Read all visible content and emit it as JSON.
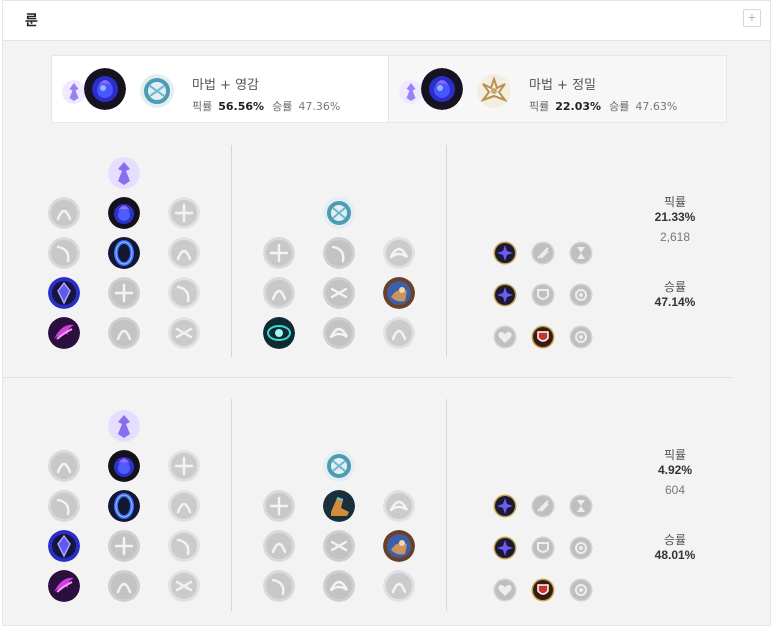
{
  "header": {
    "title": "룬",
    "add_button": "+"
  },
  "summaries": [
    {
      "primary": "마법",
      "secondary": "영감",
      "title": "마법 + 영감",
      "pick_label": "픽률",
      "pick_value": "56.56%",
      "win_label": "승률",
      "win_value": "47.36%"
    },
    {
      "primary": "마법",
      "secondary": "정밀",
      "title": "마법 + 정밀",
      "pick_label": "픽률",
      "pick_value": "22.03%",
      "win_label": "승률",
      "win_value": "47.63%"
    }
  ],
  "builds": [
    {
      "stats": {
        "pick_label": "픽률",
        "pick_value": "21.33%",
        "games": "2,618",
        "win_label": "승률",
        "win_value": "47.14%"
      },
      "primary_tree": "sorcery",
      "primary_keystones": [
        "summon-aery",
        "arcane-comet",
        "phase-rush"
      ],
      "selected_primary": [
        "arcane-comet",
        "manaflow-band",
        "transcendence",
        "scorch"
      ],
      "secondary_tree": "inspiration",
      "selected_secondary": [
        "cosmic-insight",
        "biscuit-delivery"
      ],
      "shards": [
        "adaptive-force",
        "adaptive-force",
        "health-scaling"
      ]
    },
    {
      "stats": {
        "pick_label": "픽률",
        "pick_value": "4.92%",
        "games": "604",
        "win_label": "승률",
        "win_value": "48.01%"
      },
      "primary_tree": "sorcery",
      "primary_keystones": [
        "summon-aery",
        "arcane-comet",
        "phase-rush"
      ],
      "selected_primary": [
        "arcane-comet",
        "manaflow-band",
        "transcendence",
        "scorch"
      ],
      "secondary_tree": "inspiration",
      "selected_secondary": [
        "magical-footwear",
        "biscuit-delivery"
      ],
      "shards": [
        "adaptive-force",
        "adaptive-force",
        "health-scaling"
      ]
    }
  ],
  "colors": {
    "panel_bg": "#f3f3f4",
    "sorcery": "#7b5cf0",
    "comet_blue": "#2a36c8",
    "inspiration": "#49a0b8",
    "precision": "#c8aa6e",
    "inactive": "#b9b9bc",
    "shard_ring": "#c8a34a"
  }
}
